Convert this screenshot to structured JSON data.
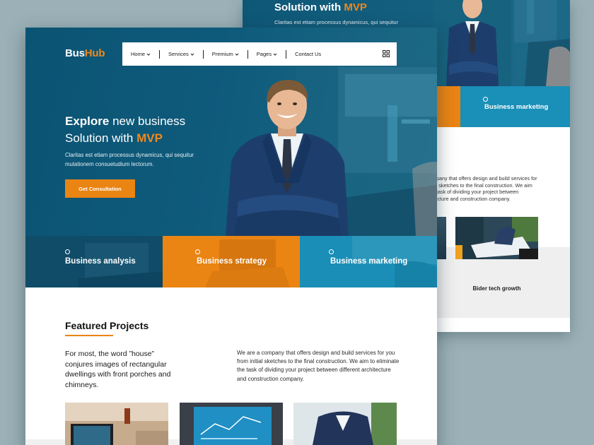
{
  "back_page": {
    "hero_title_prefix": "Solution with",
    "hero_title_accent": "MVP",
    "hero_subtitle": "Claritas est etiam processus dynamicus, qui sequitur",
    "card_label": "Business marketing",
    "description_lines": [
      "mpany that offers design and build services for",
      "ial sketches to the final construction. We aim",
      "e task of dividing your project between",
      "itecture and construction company."
    ],
    "project_caption": "Bider tech growth"
  },
  "header": {
    "logo_part1": "Bus",
    "logo_part2": "Hub",
    "nav": [
      {
        "label": "Home",
        "dropdown": true
      },
      {
        "label": "Services",
        "dropdown": true
      },
      {
        "label": "Premium",
        "dropdown": true
      },
      {
        "label": "Pages",
        "dropdown": true
      },
      {
        "label": "Contact Us",
        "dropdown": false
      }
    ]
  },
  "hero": {
    "title_word1": "Explore",
    "title_word2": "new business",
    "title_line2_prefix": "Solution with",
    "title_accent": "MVP",
    "subtitle_line1": "Claritas est etiam processus dynamicus, qui sequitur",
    "subtitle_line2": "mutationem consuetudium lectorum.",
    "cta_label": "Get Consultation"
  },
  "services": [
    {
      "label": "Business analysis"
    },
    {
      "label": "Business strategy"
    },
    {
      "label": "Business marketing"
    }
  ],
  "featured": {
    "title": "Featured Projects",
    "lead": "For most, the word ”house” conjures images of rectangular dwellings with front porches and chimneys.",
    "description": "We are a company that offers design and build services for you from initial sketches to the final construction. We aim to eliminate the task of dividing your project between different architecture and construction company."
  },
  "colors": {
    "brand_blue": "#0f5b7c",
    "accent_orange": "#ea8413",
    "card_blue": "#1a8eb6",
    "background": "#9bb1b7"
  }
}
